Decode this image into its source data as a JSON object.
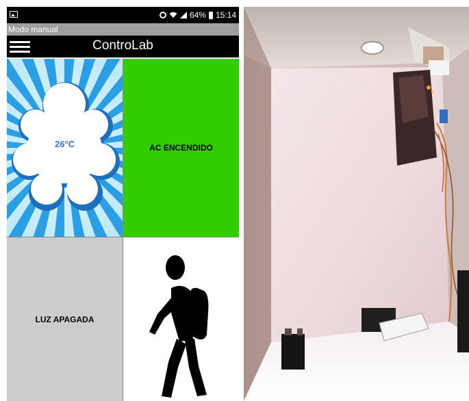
{
  "status_bar": {
    "battery": "64%",
    "time": "15:14",
    "icons": [
      "gallery-icon",
      "alarm-icon",
      "wifi-icon",
      "signal-icon",
      "battery-icon"
    ]
  },
  "title_bar": {
    "title": "Modo manual"
  },
  "app_bar": {
    "title": "ControLab",
    "menu_icon": "hamburger-menu-icon"
  },
  "tiles": {
    "temperature": {
      "value": "26°C",
      "icon": "cloud-sunburst-icon"
    },
    "ac": {
      "label": "AC ENCENDIDO",
      "color": "#33cc00"
    },
    "light": {
      "label": "LUZ APAGADA",
      "color": "#cccccc"
    },
    "presence": {
      "icon": "person-walking-icon"
    }
  },
  "photo": {
    "subject": "device-enclosure-photo"
  }
}
